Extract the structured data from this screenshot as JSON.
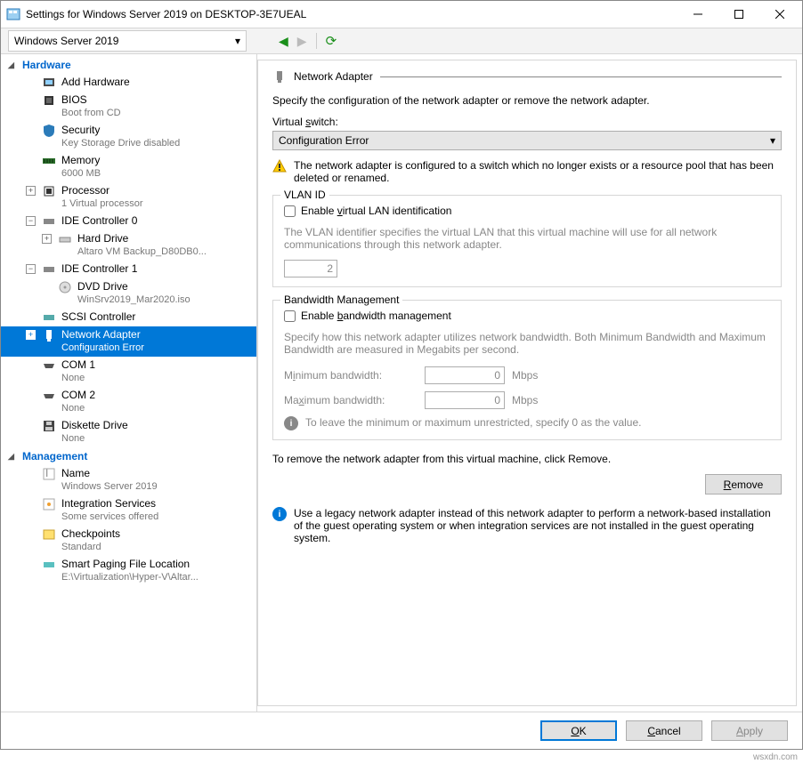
{
  "window": {
    "title": "Settings for Windows Server 2019 on DESKTOP-3E7UEAL"
  },
  "toolbar": {
    "vm_name": "Windows Server 2019"
  },
  "sidebar": {
    "hardware_header": "Hardware",
    "management_header": "Management",
    "items": {
      "add_hardware": "Add Hardware",
      "bios": "BIOS",
      "bios_sub": "Boot from CD",
      "security": "Security",
      "security_sub": "Key Storage Drive disabled",
      "memory": "Memory",
      "memory_sub": "6000 MB",
      "processor": "Processor",
      "processor_sub": "1 Virtual processor",
      "ide0": "IDE Controller 0",
      "hard_drive": "Hard Drive",
      "hard_drive_sub": "Altaro VM Backup_D80DB0...",
      "ide1": "IDE Controller 1",
      "dvd": "DVD Drive",
      "dvd_sub": "WinSrv2019_Mar2020.iso",
      "scsi": "SCSI Controller",
      "net": "Network Adapter",
      "net_sub": "Configuration Error",
      "com1": "COM 1",
      "com1_sub": "None",
      "com2": "COM 2",
      "com2_sub": "None",
      "diskette": "Diskette Drive",
      "diskette_sub": "None",
      "name": "Name",
      "name_sub": "Windows Server 2019",
      "integration": "Integration Services",
      "integration_sub": "Some services offered",
      "checkpoints": "Checkpoints",
      "checkpoints_sub": "Standard",
      "paging": "Smart Paging File Location",
      "paging_sub": "E:\\Virtualization\\Hyper-V\\Altar..."
    }
  },
  "panel": {
    "title": "Network Adapter",
    "desc": "Specify the configuration of the network adapter or remove the network adapter.",
    "vswitch_label": "Virtual switch:",
    "vswitch_value": "Configuration Error",
    "warning": "The network adapter is configured to a switch which no longer exists or a resource pool that has been deleted or renamed.",
    "vlan": {
      "title": "VLAN ID",
      "checkbox": "Enable virtual LAN identification",
      "desc": "The VLAN identifier specifies the virtual LAN that this virtual machine will use for all network communications through this network adapter.",
      "value": "2"
    },
    "bw": {
      "title": "Bandwidth Management",
      "checkbox": "Enable bandwidth management",
      "desc": "Specify how this network adapter utilizes network bandwidth. Both Minimum Bandwidth and Maximum Bandwidth are measured in Megabits per second.",
      "min_label": "Minimum bandwidth:",
      "min_value": "0",
      "max_label": "Maximum bandwidth:",
      "max_value": "0",
      "unit": "Mbps",
      "hint": "To leave the minimum or maximum unrestricted, specify 0 as the value."
    },
    "remove_text": "To remove the network adapter from this virtual machine, click Remove.",
    "remove_btn": "Remove",
    "legacy": "Use a legacy network adapter instead of this network adapter to perform a network-based installation of the guest operating system or when integration services are not installed in the guest operating system."
  },
  "footer": {
    "ok": "OK",
    "cancel": "Cancel",
    "apply": "Apply"
  },
  "watermark": "wsxdn.com"
}
